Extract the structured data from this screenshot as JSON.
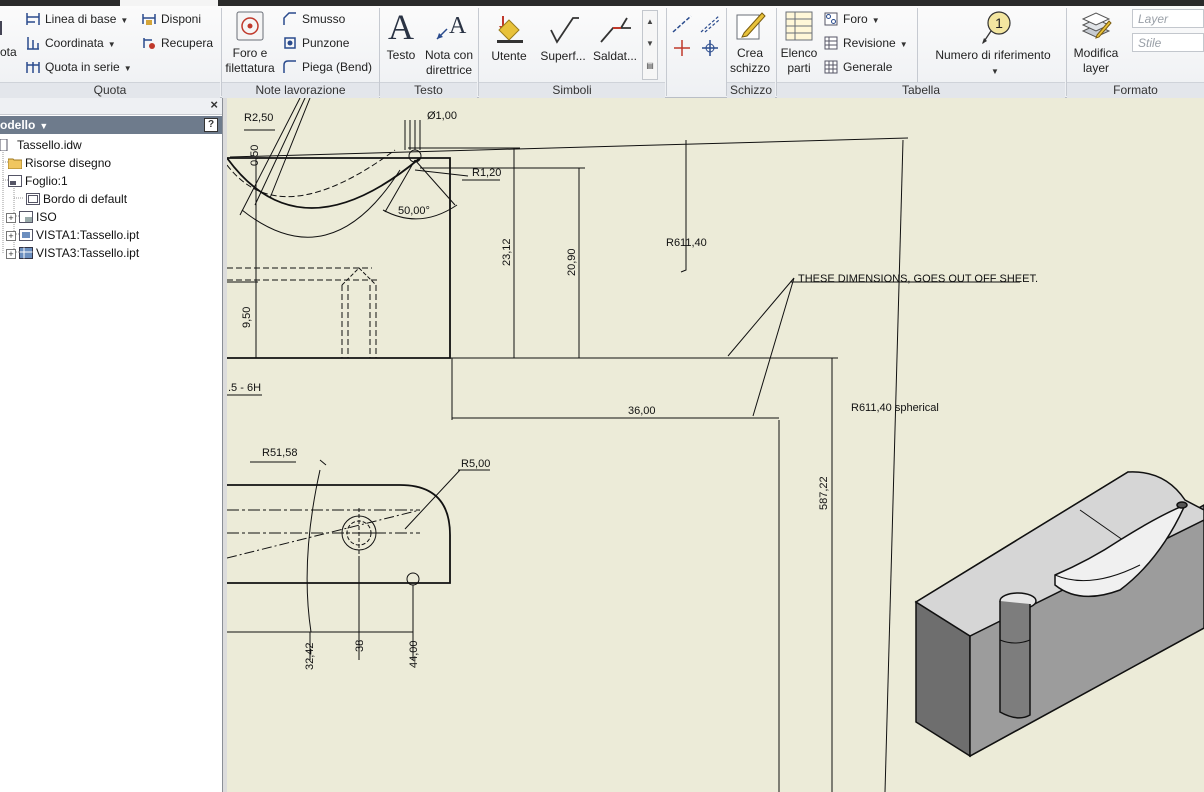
{
  "ribbon": {
    "quota": {
      "cut_label": "ota",
      "linea_di_base": "Linea di base",
      "coordinata": "Coordinata",
      "quota_in_serie": "Quota in serie",
      "disponi": "Disponi",
      "recupera": "Recupera",
      "panel": "Quota"
    },
    "note": {
      "foro_filettatura_1": "Foro e",
      "foro_filettatura_2": "filettatura",
      "smusso": "Smusso",
      "punzone": "Punzone",
      "piega": "Piega (Bend)",
      "panel": "Note lavorazione"
    },
    "testo": {
      "testo": "Testo",
      "nota_1": "Nota con",
      "nota_2": "direttrice",
      "panel": "Testo"
    },
    "simboli": {
      "utente": "Utente",
      "superf": "Superf...",
      "saldat": "Saldat...",
      "panel": "Simboli"
    },
    "schizzo": {
      "crea_1": "Crea",
      "crea_2": "schizzo",
      "panel": "Schizzo"
    },
    "tabella": {
      "elenco_1": "Elenco",
      "elenco_2": "parti",
      "foro": "Foro",
      "revisione": "Revisione",
      "generale": "Generale",
      "numero": "Numero di riferimento",
      "balloon_number": "1",
      "panel": "Tabella"
    },
    "formato": {
      "modifica_1": "Modifica",
      "modifica_2": "layer",
      "layer_placeholder": "Layer",
      "stile_placeholder": "Stile",
      "panel": "Formato"
    }
  },
  "browser": {
    "header": "odello",
    "help": "?",
    "close": "×",
    "items": [
      {
        "label": "Tassello.idw"
      },
      {
        "label": "Risorse disegno"
      },
      {
        "label": "Foglio:1"
      },
      {
        "label": "Bordo di default"
      },
      {
        "label": "ISO"
      },
      {
        "label": "VISTA1:Tassello.ipt"
      },
      {
        "label": "VISTA3:Tassello.ipt"
      }
    ]
  },
  "drawing": {
    "dims": {
      "r250": "R2,50",
      "d100": "Ø1,00",
      "v050": "0,50",
      "r120": "R1,20",
      "a50": "50,00°",
      "v2312": "23,12",
      "v2090": "20,90",
      "r61140": "R611,40",
      "note": "THESE DIMENSIONS, GOES OUT OFF SHEET.",
      "v950": "9,50",
      "thread": ".5 - 6H",
      "h3600": "36,00",
      "r61140s": "R611,40 spherical",
      "r5158": "R51,58",
      "r500": "R5,00",
      "v58722": "587,22",
      "v3242": "32,42",
      "v38": "38",
      "v4400": "44,00"
    }
  }
}
